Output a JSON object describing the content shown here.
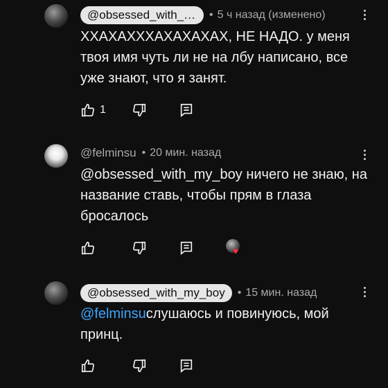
{
  "comments": [
    {
      "author": "@obsessed_with_my_boy",
      "time": "5 ч назад (изменено)",
      "text": "ХХАХАХХХАХАХАХАХ, НЕ НАДО. у меня твоя имя чуть ли не на лбу написано, все уже знают, что я занят.",
      "likes": "1"
    },
    {
      "author": "@felminsu",
      "time": "20 мин. назад",
      "text": "@obsessed_with_my_boy ничего не знаю, на название ставь, чтобы прям в глаза бросалось",
      "likes": ""
    },
    {
      "author": "@obsessed_with_my_boy",
      "time": "15 мин. назад",
      "mention": "@felminsu",
      "text": "слушаюсь и повинуюсь, мой принц.",
      "likes": ""
    }
  ],
  "icons": {
    "like": "thumb-up-icon",
    "dislike": "thumb-down-icon",
    "reply": "reply-icon",
    "menu": "more-vert-icon",
    "creator_heart": "creator-heart-icon"
  },
  "colors": {
    "background": "#0f0f0f",
    "mention": "#3ea6ff",
    "heart": "#ff3040",
    "chip": "#e6e6e6"
  }
}
